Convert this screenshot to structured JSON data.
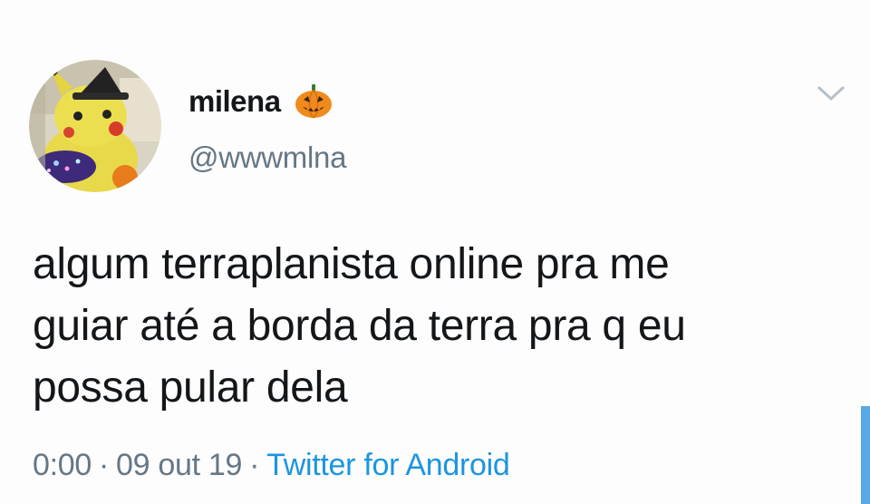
{
  "tweet": {
    "display_name": "milena",
    "name_emoji": "jack-o-lantern-icon",
    "handle": "@wwwmlna",
    "text_lines": [
      "algum terraplanista online pra me",
      "guiar até a borda da terra pra q eu",
      "possa pular dela"
    ],
    "time": "0:00",
    "date": "09 out 19",
    "separator": "·",
    "source": "Twitter for Android"
  },
  "icons": {
    "menu": "chevron-down-icon",
    "avatar": "avatar-pikachu-plush"
  },
  "colors": {
    "text_primary": "#14171a",
    "text_secondary": "#657786",
    "link": "#1b95e0",
    "pumpkin": "#f18a1d"
  }
}
